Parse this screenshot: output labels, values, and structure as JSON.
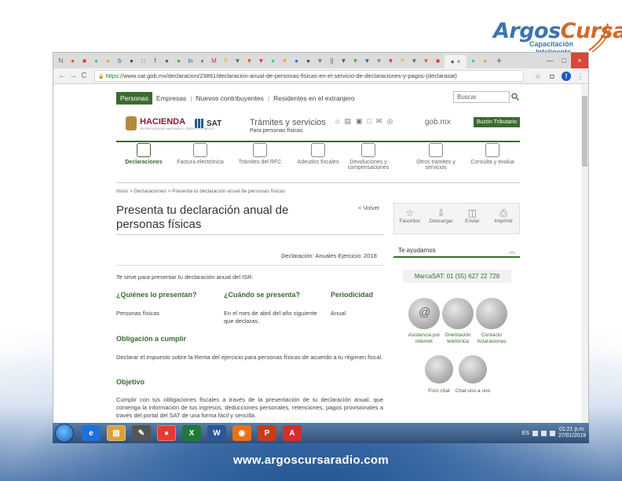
{
  "branding": {
    "logo_main_a": "Argos",
    "logo_main_b": "Cursa",
    "logo_sub1": "Capacitación",
    "logo_sub2": "Inteligente",
    "website": "www.argoscursaradio.com"
  },
  "browser": {
    "tabs": [
      "N",
      "●",
      "■",
      "●",
      "●",
      "b",
      "●",
      "□",
      "f",
      "●",
      "●",
      "in",
      "●",
      "M",
      "▼",
      "▼",
      "▼",
      "▼",
      "●",
      "▼",
      "●",
      "●",
      "▼",
      "||",
      "▼",
      "▼",
      "▼",
      "▼",
      "▼",
      "▼",
      "▼",
      "▼",
      "■",
      "●",
      "●"
    ],
    "active_tab_close": "×",
    "new_tab": "+",
    "win_min": "—",
    "win_max": "□",
    "win_close": "×",
    "nav_back": "←",
    "nav_forward": "→",
    "nav_reload": "C",
    "secure_lock": "🔒",
    "url_scheme": "https://",
    "url_rest": "www.sat.gob.mx/declaracion/23891/declaracion-anual-de-personas-fisicas-en-el-servicio-de-declaraciones-y-pagos-(declarasat)",
    "star": "☆",
    "ext1": "◘",
    "ext2": "!",
    "menu": "⋮"
  },
  "site": {
    "nav": {
      "personas": "Personas",
      "empresas": "Empresas",
      "nuevos": "Nuevos contribuyentes",
      "residentes": "Residentes en el extranjero"
    },
    "search_placeholder": "Buscar",
    "hacienda": "HACIENDA",
    "hacienda_sub": "SECRETARÍA DE HACIENDA Y CRÉDITO PÚBLICO",
    "sat": "SAT",
    "tramites": "Trámites y servicios",
    "tramites_sub": "Para personas físicas",
    "header_icons": [
      "⌂",
      "▤",
      "▣",
      "□",
      "✉",
      "◎"
    ],
    "gobmx": "gob.mx",
    "buzon": "Buzón Tributario",
    "categories": [
      {
        "label": "Declaraciones",
        "active": true
      },
      {
        "label": "Factura electrónica"
      },
      {
        "label": "Trámites del RFC"
      },
      {
        "label": "Adeudos fiscales"
      },
      {
        "label": "Devoluciones y compensaciones"
      },
      {
        "label": "Otros trámites y servicios"
      },
      {
        "label": "Consulta y evalúa"
      }
    ],
    "breadcrumb": "Inicio > Declaraciones > Presenta tu declaración anual de personas físicas",
    "title": "Presenta tu declaración anual de personas físicas",
    "volver": "< Volver",
    "meta": "Declaración: Anuales   Ejercicio: 2018",
    "intro": "Te sirve para presentar tu declaración anual del ISR.",
    "quien_h": "¿Quiénes lo presentan?",
    "cuando_h": "¿Cuándo se presenta?",
    "periodicidad_h": "Periodicidad",
    "quien": "Personas físicas",
    "cuando": "En el mes de abril del año siguiente que declaras.",
    "periodicidad": "Anual",
    "obligacion_h": "Obligación a cumplir",
    "obligacion": "Declarar el impuesto sobre la Renta del ejercicio para personas físicas de acuerdo a tu régimen fiscal.",
    "objetivo_h": "Objetivo",
    "objetivo": "Cumplir con tus obligaciones fiscales a través de la presentación de tu declaración anual, que contenga la información de tus ingresos, deducciones personales, retenciones, pagos provisionales a través del portal del SAT de una forma fácil y sencilla.",
    "tools": [
      {
        "icon": "☆",
        "label": "Favoritos"
      },
      {
        "icon": "⇩",
        "label": "Descargar"
      },
      {
        "icon": "◫",
        "label": "Enviar"
      },
      {
        "icon": "⎙",
        "label": "Imprimir"
      }
    ],
    "ayudamos": "Te ayudamos",
    "ayudamos_chev": "︿",
    "marcasat": "MarcaSAT: 01 (55) 627 22 728",
    "help": [
      {
        "label": "Asistencia por internet"
      },
      {
        "label": "Orientación telefónica"
      },
      {
        "label": "Contacto Aclaraciones"
      },
      {
        "label": "Foro chat"
      },
      {
        "label": "Chat uno a uno"
      }
    ]
  },
  "taskbar": {
    "apps": [
      "e",
      "▤",
      "✎",
      "●",
      "X",
      "W",
      "◉",
      "P",
      "A"
    ],
    "lang": "ES",
    "time": "01:21 p.m.",
    "date": "27/01/2019"
  }
}
